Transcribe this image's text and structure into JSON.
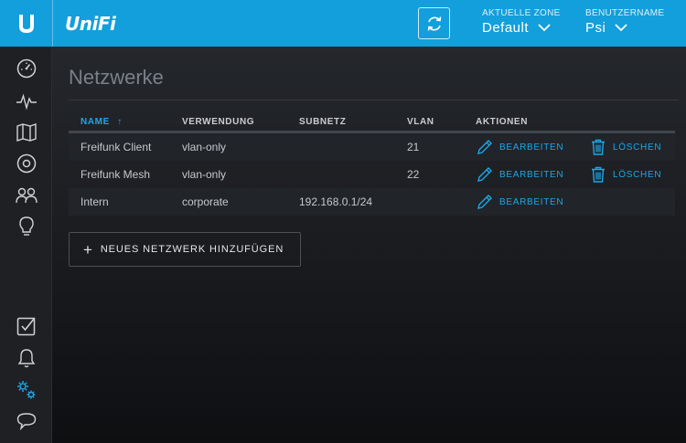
{
  "header": {
    "brand": "UniFi",
    "zone_label": "AKTUELLE ZONE",
    "zone_value": "Default",
    "user_label": "BENUTZERNAME",
    "user_value": "Psi",
    "accent_color": "#139fdb"
  },
  "sidebar": {
    "items": [
      {
        "icon": "dashboard-icon"
      },
      {
        "icon": "statistics-icon"
      },
      {
        "icon": "map-icon"
      },
      {
        "icon": "devices-icon"
      },
      {
        "icon": "clients-icon"
      },
      {
        "icon": "insights-icon"
      },
      {
        "icon": "alerts-checklist-icon"
      },
      {
        "icon": "notifications-bell-icon"
      },
      {
        "icon": "settings-gears-icon",
        "active": true
      },
      {
        "icon": "chat-support-icon"
      }
    ]
  },
  "page": {
    "title": "Netzwerke"
  },
  "table": {
    "columns": {
      "name": "NAME",
      "usage": "VERWENDUNG",
      "subnet": "SUBNETZ",
      "vlan": "VLAN",
      "actions": "AKTIONEN"
    },
    "sort_indicator": "↑",
    "rows": [
      {
        "name": "Freifunk Client",
        "usage": "vlan-only",
        "subnet": "",
        "vlan": "21",
        "edit": "BEARBEITEN",
        "delete": "LÖSCHEN"
      },
      {
        "name": "Freifunk Mesh",
        "usage": "vlan-only",
        "subnet": "",
        "vlan": "22",
        "edit": "BEARBEITEN",
        "delete": "LÖSCHEN"
      },
      {
        "name": "Intern",
        "usage": "corporate",
        "subnet": "192.168.0.1/24",
        "vlan": "",
        "edit": "BEARBEITEN",
        "delete": ""
      }
    ]
  },
  "actions": {
    "add_network": "NEUES NETZWERK HINZUFÜGEN"
  }
}
